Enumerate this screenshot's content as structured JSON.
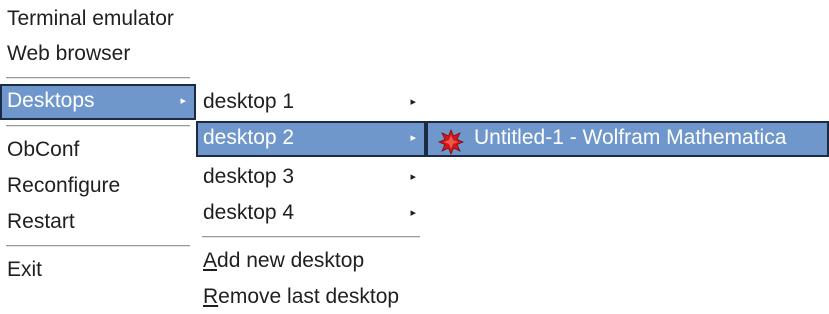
{
  "root_menu": {
    "items": [
      {
        "label": "Terminal emulator"
      },
      {
        "label": "Web browser"
      },
      {
        "label": "Desktops",
        "arrow": "▸"
      },
      {
        "label": "ObConf"
      },
      {
        "label": "Reconfigure"
      },
      {
        "label": "Restart"
      },
      {
        "label": "Exit"
      }
    ]
  },
  "desktops_menu": {
    "items": [
      {
        "label": "desktop 1",
        "arrow": "▸"
      },
      {
        "label": "desktop 2",
        "arrow": "▸"
      },
      {
        "label": "desktop 3",
        "arrow": "▸"
      },
      {
        "label": "desktop 4",
        "arrow": "▸"
      }
    ],
    "add": {
      "accel": "A",
      "rest": "dd new desktop"
    },
    "remove": {
      "accel": "R",
      "rest": "emove last desktop"
    }
  },
  "windows_menu": {
    "items": [
      {
        "label": "Untitled-1 - Wolfram Mathematica",
        "icon": "mathematica-icon"
      }
    ]
  },
  "colors": {
    "selection_bg": "#6f97cc",
    "selection_border": "#1b2b44",
    "text": "#1f1f1f"
  }
}
